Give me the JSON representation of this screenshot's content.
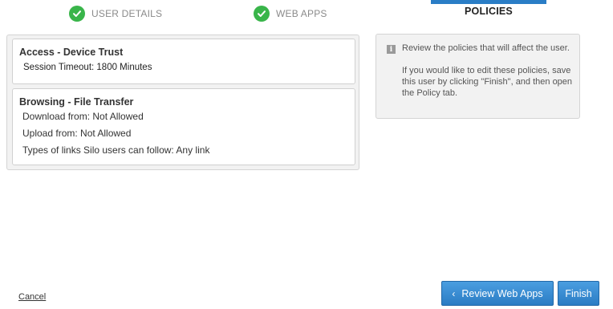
{
  "wizard": {
    "steps": [
      {
        "label": "USER DETAILS",
        "status": "complete",
        "icon": "check-icon"
      },
      {
        "label": "WEB APPS",
        "status": "complete",
        "icon": "check-icon"
      },
      {
        "label": "POLICIES",
        "status": "active"
      }
    ]
  },
  "policies": {
    "access": {
      "title": "Access - Device Trust",
      "lines": [
        "Session Timeout: 1800 Minutes"
      ]
    },
    "browsing": {
      "title": "Browsing - File Transfer",
      "lines": [
        "Download from: Not Allowed",
        "Upload from: Not Allowed",
        "Types of links Silo users can follow: Any link"
      ]
    }
  },
  "info": {
    "icon": "info-icon",
    "icon_glyph": "i",
    "paragraph_1": "Review the policies that will affect the user.",
    "paragraph_2": "If you would like to edit these policies, save this user by clicking \"Finish\", and then open the Policy tab."
  },
  "footer": {
    "cancel_label": "Cancel",
    "back_icon": "‹",
    "back_label": "Review Web Apps",
    "finish_label": "Finish"
  },
  "colors": {
    "accent": "#2a7dc6",
    "check": "#39b54a",
    "panel_bg": "#f2f2f2"
  }
}
